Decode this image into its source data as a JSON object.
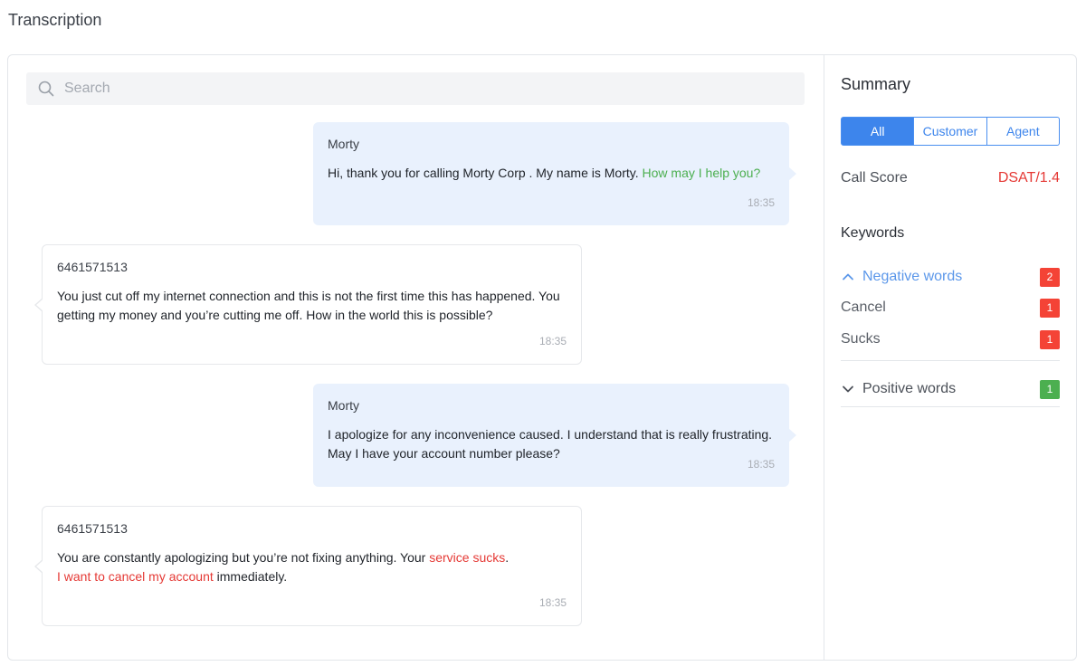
{
  "page": {
    "title": "Transcription"
  },
  "search": {
    "placeholder": "Search"
  },
  "messages": [
    {
      "role": "agent",
      "sender": "Morty",
      "segments": [
        {
          "text": "Hi, thank you for calling Morty Corp . My name is Morty. "
        },
        {
          "text": "How may I help you?",
          "highlight": "positive"
        }
      ],
      "time": "18:35"
    },
    {
      "role": "customer",
      "sender": "6461571513",
      "segments": [
        {
          "text": "You just cut off my internet connection and this is not the first time this has happened. You getting my money and you’re cutting me off. How in the world this is possible?"
        }
      ],
      "time": "18:35"
    },
    {
      "role": "agent",
      "sender": "Morty",
      "segments": [
        {
          "text": "I apologize for any inconvenience caused. I understand that is really frustrating. May I have your account number please?"
        }
      ],
      "time": "18:35"
    },
    {
      "role": "customer",
      "sender": "6461571513",
      "segments": [
        {
          "text": "You are constantly apologizing but you’re not fixing anything. Your "
        },
        {
          "text": "service sucks",
          "highlight": "negative"
        },
        {
          "text": ". "
        },
        {
          "text": "I want to cancel my account",
          "highlight": "negative"
        },
        {
          "text": " immediately."
        }
      ],
      "time": "18:35"
    }
  ],
  "summary": {
    "title": "Summary",
    "filters": [
      {
        "label": "All",
        "active": true
      },
      {
        "label": "Customer",
        "active": false
      },
      {
        "label": "Agent",
        "active": false
      }
    ],
    "call_score": {
      "label": "Call Score",
      "value": "DSAT/1.4"
    },
    "keywords": {
      "title": "Keywords",
      "negative": {
        "label": "Negative words",
        "count": "2",
        "expanded": true,
        "items": [
          {
            "label": "Cancel",
            "count": "1"
          },
          {
            "label": "Sucks",
            "count": "1"
          }
        ]
      },
      "positive": {
        "label": "Positive words",
        "count": "1",
        "expanded": false
      }
    }
  },
  "colors": {
    "accent": "#3d85ec",
    "negative": "#f44336",
    "positive": "#4caf50",
    "agent_bubble": "#e9f1fd"
  }
}
